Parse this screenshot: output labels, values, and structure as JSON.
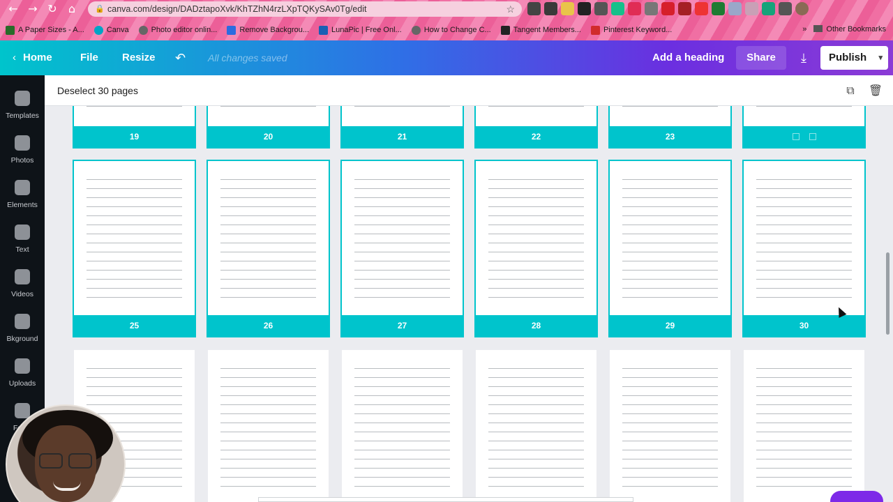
{
  "browser": {
    "url": "canva.com/design/DADztapoXvk/KhTZhN4rzLXpTQKySAv0Tg/edit",
    "bookmarks": [
      "A Paper Sizes - A...",
      "Canva",
      "Photo editor onlin...",
      "Remove Backgrou...",
      "LunaPic | Free Onl...",
      "How to Change C...",
      "Tangent Members...",
      "Pinterest Keyword..."
    ],
    "other_bookmarks": "Other Bookmarks",
    "more_bookmarks": "»"
  },
  "header": {
    "home": "Home",
    "file": "File",
    "resize": "Resize",
    "saved_status": "All changes saved",
    "add_heading": "Add a heading",
    "share": "Share",
    "publish": "Publish"
  },
  "sidebar": {
    "items": [
      {
        "label": "Templates"
      },
      {
        "label": "Photos"
      },
      {
        "label": "Elements"
      },
      {
        "label": "Text"
      },
      {
        "label": "Videos"
      },
      {
        "label": "Bkground"
      },
      {
        "label": "Uploads"
      },
      {
        "label": "Folde"
      }
    ]
  },
  "pagebar": {
    "deselect_label": "Deselect 30 pages"
  },
  "pages": {
    "row1": [
      "19",
      "20",
      "21",
      "22",
      "23",
      ""
    ],
    "row2": [
      "25",
      "26",
      "27",
      "28",
      "29",
      "30"
    ]
  }
}
